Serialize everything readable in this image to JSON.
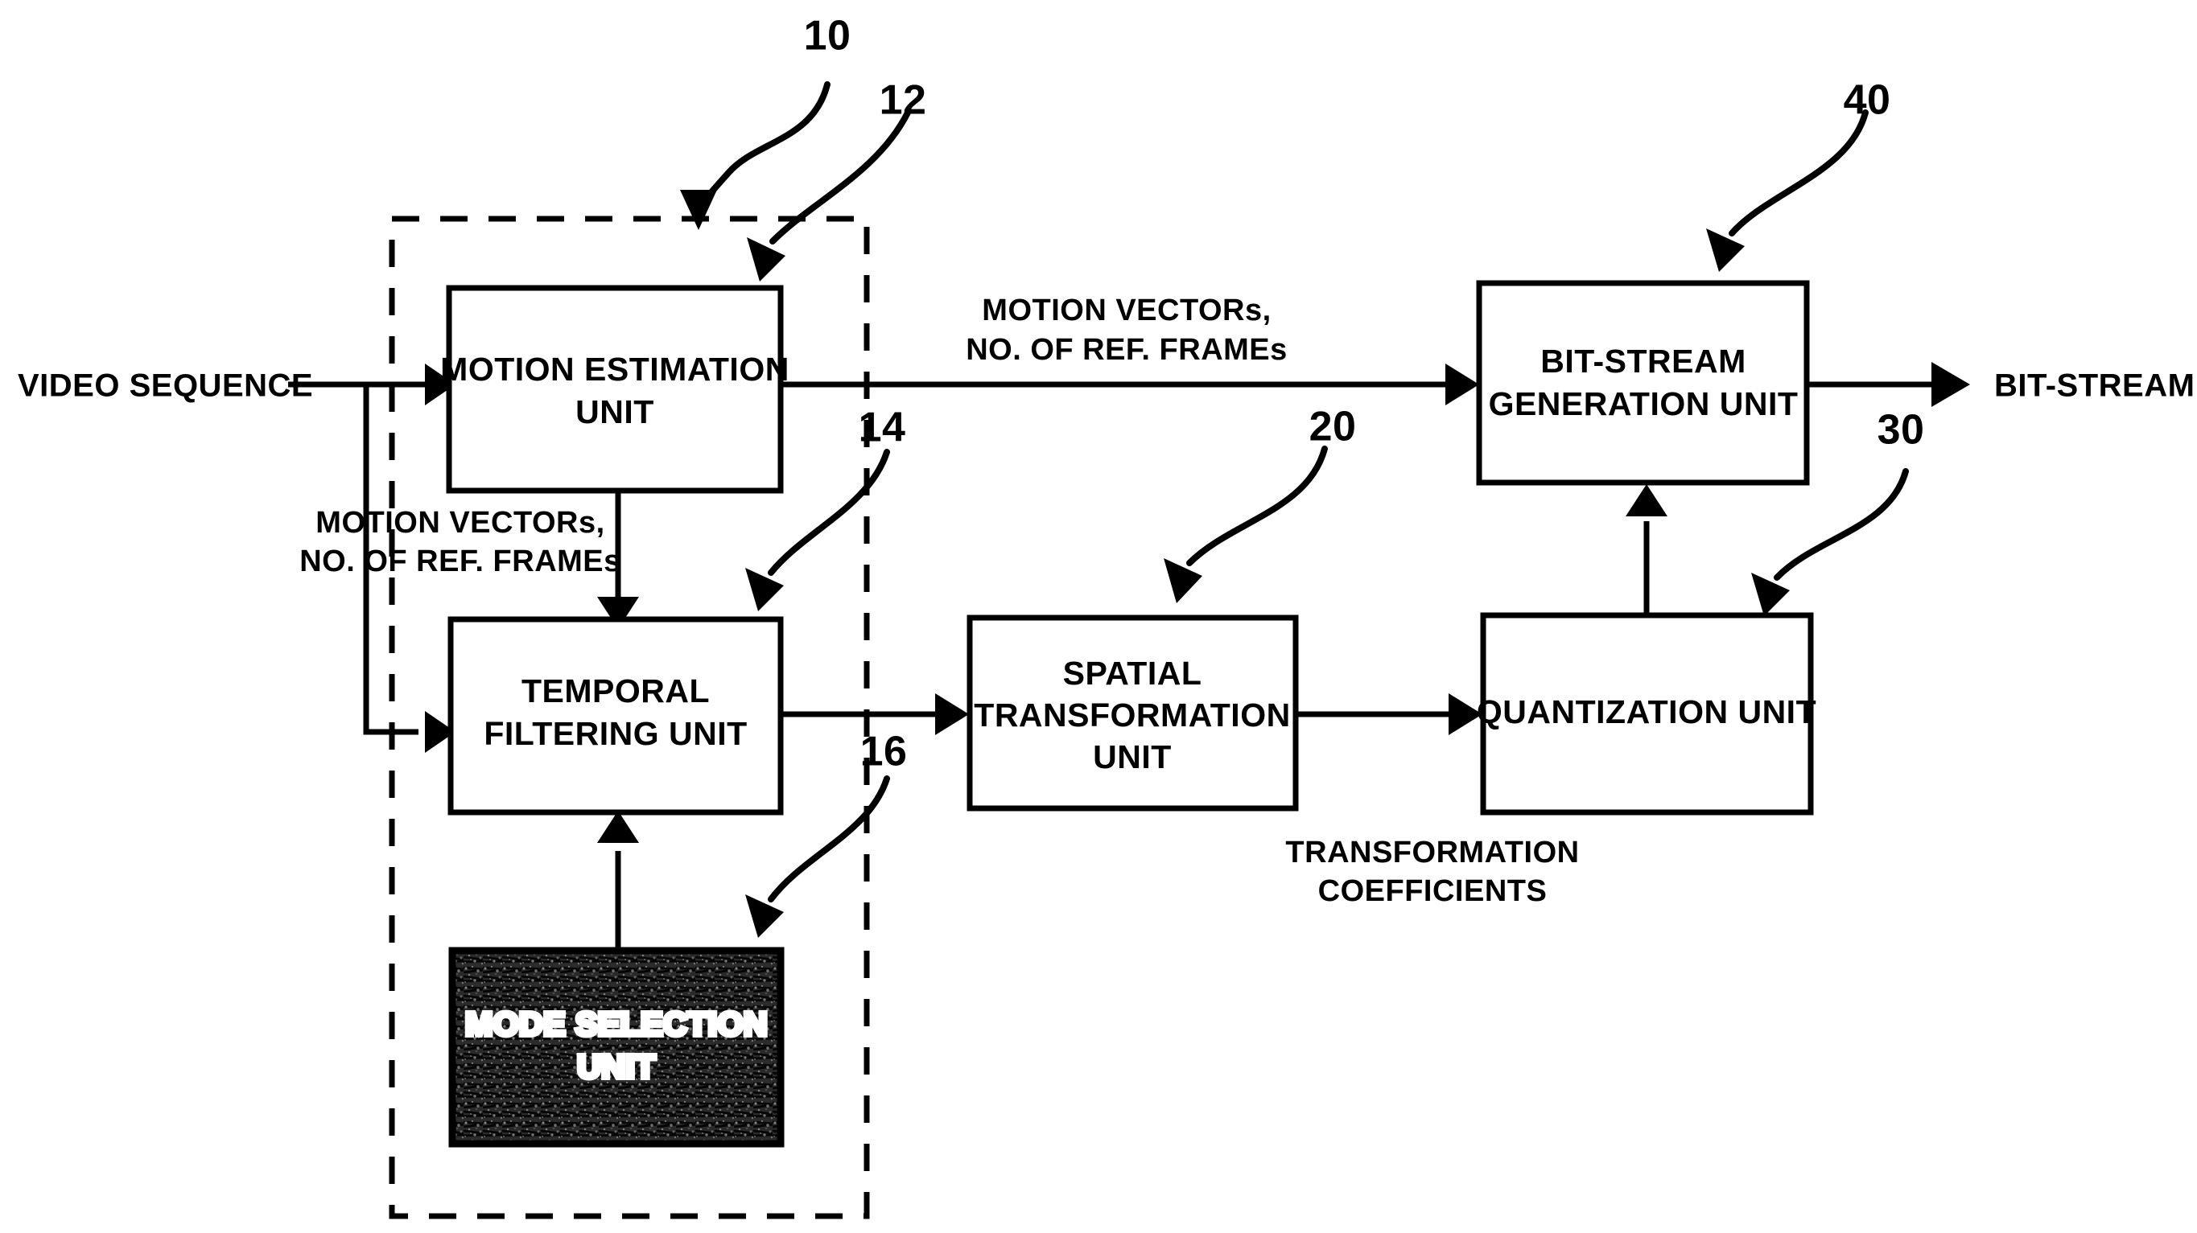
{
  "figure": {
    "type": "patent-block-diagram",
    "title": "Video encoder block diagram",
    "background_color": "#ffffff",
    "line_color": "#000000"
  },
  "io": {
    "input_label": "VIDEO SEQUENCE",
    "output_label": "BIT-STREAM"
  },
  "blocks": [
    {
      "id": "motion-estimation-unit",
      "label_line1": "MOTION ESTIMATION",
      "label_line2": "UNIT",
      "ref": "12",
      "shaded": false
    },
    {
      "id": "temporal-filtering-unit",
      "label_line1": "TEMPORAL",
      "label_line2": "FILTERING UNIT",
      "ref": "14",
      "shaded": false
    },
    {
      "id": "mode-selection-unit",
      "label_line1": "MODE SELECTION",
      "label_line2": "UNIT",
      "ref": "16",
      "shaded": true
    },
    {
      "id": "spatial-transformation-unit",
      "label_line1": "SPATIAL",
      "label_line2": "TRANSFORMATION",
      "label_line3": "UNIT",
      "ref": "20",
      "shaded": false
    },
    {
      "id": "quantization-unit",
      "label_line1": "QUANTIZATION UNIT",
      "ref": "30",
      "shaded": false
    },
    {
      "id": "bit-stream-generation-unit",
      "label_line1": "BIT-STREAM",
      "label_line2": "GENERATION UNIT",
      "ref": "40",
      "shaded": false
    }
  ],
  "signal_labels": {
    "motion_vectors_left_line1": "MOTION VECTORs,",
    "motion_vectors_left_line2": "NO. OF REF. FRAMEs",
    "motion_vectors_top_line1": "MOTION VECTORs,",
    "motion_vectors_top_line2": "NO. OF REF. FRAMEs",
    "transformation_coefficients_line1": "TRANSFORMATION",
    "transformation_coefficients_line2": "COEFFICIENTS"
  },
  "reference_numerals": {
    "group": "10",
    "motion_estimation": "12",
    "temporal_filtering": "14",
    "mode_selection": "16",
    "spatial_transformation": "20",
    "quantization": "30",
    "bit_stream_generation": "40"
  }
}
